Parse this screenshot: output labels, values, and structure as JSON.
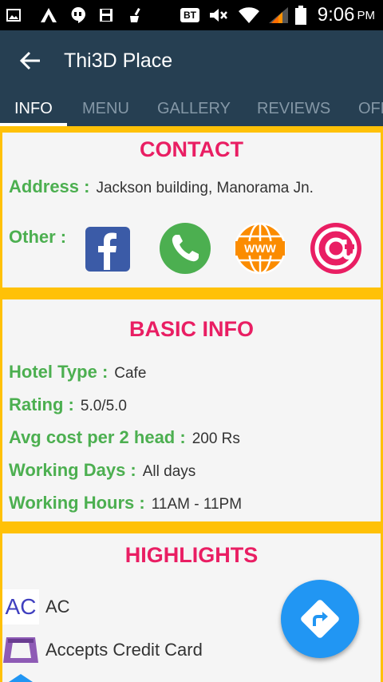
{
  "status_bar": {
    "time": "9:06",
    "ampm": "PM",
    "carrier_badge": "BT"
  },
  "app_bar": {
    "title": "Thi3D Place"
  },
  "tabs": [
    {
      "label": "INFO",
      "active": true
    },
    {
      "label": "MENU",
      "active": false
    },
    {
      "label": "GALLERY",
      "active": false
    },
    {
      "label": "REVIEWS",
      "active": false
    },
    {
      "label": "OFF",
      "active": false
    }
  ],
  "contact": {
    "title": "CONTACT",
    "address_label": "Address :",
    "address_value": "Jackson building, Manorama Jn.",
    "other_label": "Other :",
    "icons": [
      "facebook-icon",
      "phone-icon",
      "www-icon",
      "email-icon"
    ]
  },
  "basic_info": {
    "title": "BASIC INFO",
    "rows": [
      {
        "label": "Hotel Type :",
        "value": "Cafe"
      },
      {
        "label": "Rating :",
        "value": "5.0/5.0"
      },
      {
        "label": "Avg cost per 2 head :",
        "value": "200 Rs"
      },
      {
        "label": "Working Days :",
        "value": "All days"
      },
      {
        "label": "Working Hours :",
        "value": "11AM - 11PM"
      }
    ]
  },
  "highlights": {
    "title": "HIGHLIGHTS",
    "items": [
      {
        "icon_text": "AC",
        "label": "AC"
      },
      {
        "icon_text": "",
        "label": "Accepts Credit Card"
      }
    ]
  },
  "colors": {
    "app_bar": "#263f52",
    "accent": "#ffc107",
    "title_pink": "#e91e63",
    "label_green": "#4caf50",
    "fab_blue": "#2196f3"
  }
}
